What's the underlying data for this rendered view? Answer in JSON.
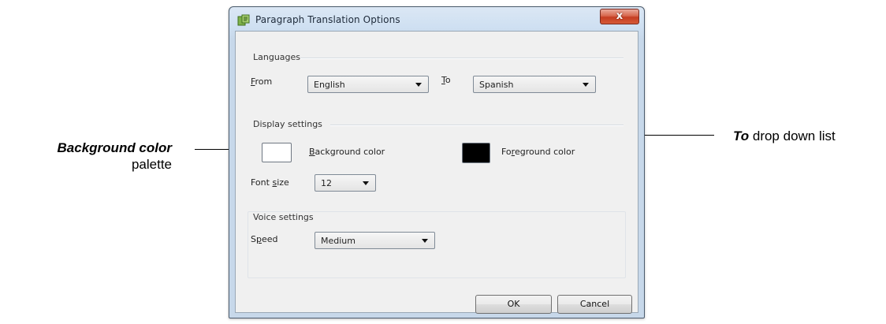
{
  "window": {
    "title": "Paragraph Translation Options",
    "close_glyph": "x"
  },
  "languages": {
    "group_label": "Languages",
    "from_label": {
      "mnemonic": "F",
      "rest": "rom"
    },
    "from_value": "English",
    "to_label": {
      "mnemonic": "T",
      "rest": "o"
    },
    "to_value": "Spanish"
  },
  "display": {
    "group_label": "Display settings",
    "background_label": {
      "mnemonic": "B",
      "rest": "ackground color"
    },
    "background_color": "#ffffff",
    "foreground_label": {
      "before": "Fo",
      "mnemonic": "r",
      "rest": "eground color"
    },
    "foreground_color": "#000000",
    "font_size_label": {
      "before": "Font ",
      "mnemonic": "s",
      "rest": "ize"
    },
    "font_size_value": "12"
  },
  "voice": {
    "group_label": "Voice settings",
    "speed_label": {
      "before": "S",
      "mnemonic": "p",
      "rest": "eed"
    },
    "speed_value": "Medium"
  },
  "buttons": {
    "ok": "OK",
    "cancel": "Cancel"
  },
  "callouts": {
    "to_list": {
      "bold": "To",
      "rest": " drop down list"
    },
    "bg_palette": {
      "bold": "Background color",
      "rest": "palette"
    }
  }
}
